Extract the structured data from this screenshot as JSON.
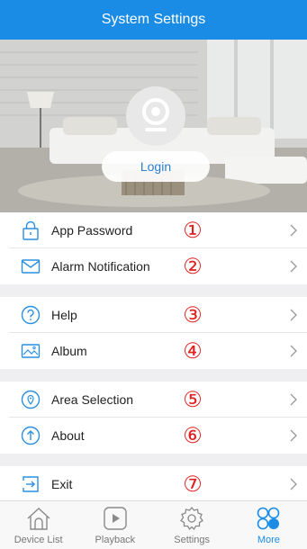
{
  "header": {
    "title": "System Settings"
  },
  "hero": {
    "login_label": "Login"
  },
  "menu": [
    {
      "label": "App Password",
      "marker": "①",
      "icon": "lock-icon"
    },
    {
      "label": "Alarm Notification",
      "marker": "②",
      "icon": "envelope-icon"
    },
    {
      "label": "Help",
      "marker": "③",
      "icon": "help-icon"
    },
    {
      "label": "Album",
      "marker": "④",
      "icon": "album-icon"
    },
    {
      "label": "Area Selection",
      "marker": "⑤",
      "icon": "location-pin-icon"
    },
    {
      "label": "About",
      "marker": "⑥",
      "icon": "arrow-up-circle-icon"
    },
    {
      "label": "Exit",
      "marker": "⑦",
      "icon": "exit-icon"
    }
  ],
  "tabs": [
    {
      "label": "Device List",
      "icon": "home-icon"
    },
    {
      "label": "Playback",
      "icon": "play-icon"
    },
    {
      "label": "Settings",
      "icon": "gear-icon"
    },
    {
      "label": "More",
      "icon": "more-grid-icon"
    }
  ],
  "colors": {
    "accent": "#1a8ce6",
    "marker": "#e02020",
    "icon_blue": "#2a8fe0"
  }
}
